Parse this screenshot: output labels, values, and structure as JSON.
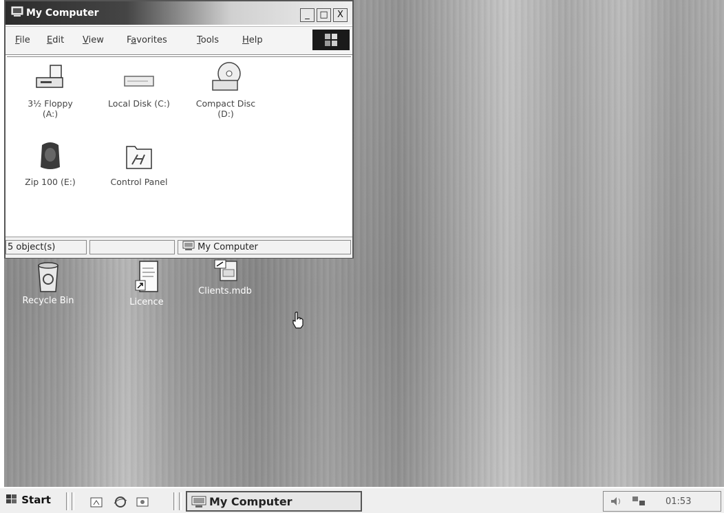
{
  "window": {
    "title": "My Computer",
    "controls": {
      "minimize": "_",
      "maximize": "□",
      "close": "X"
    },
    "menu": [
      {
        "label": "File",
        "mnemonic": "F"
      },
      {
        "label": "Edit",
        "mnemonic": "E"
      },
      {
        "label": "View",
        "mnemonic": "V"
      },
      {
        "label": "Favorites",
        "mnemonic": "a"
      },
      {
        "label": "Tools",
        "mnemonic": "T"
      },
      {
        "label": "Help",
        "mnemonic": "H"
      }
    ],
    "items": [
      {
        "line1": "3½ Floppy",
        "line2": "(A:)",
        "icon": "floppy-drive-icon"
      },
      {
        "line1": "Local Disk (C:)",
        "line2": "",
        "icon": "hard-disk-icon"
      },
      {
        "line1": "Compact Disc",
        "line2": "(D:)",
        "icon": "cd-drive-icon"
      },
      {
        "line1": "Zip 100 (E:)",
        "line2": "",
        "icon": "zip-drive-icon"
      },
      {
        "line1": "Control Panel",
        "line2": "",
        "icon": "control-panel-icon"
      }
    ],
    "status": {
      "count": "5 object(s)",
      "blank": "",
      "location": "My Computer"
    }
  },
  "desktop": {
    "icons": [
      {
        "label": "Recycle Bin",
        "icon": "recycle-bin-icon"
      },
      {
        "label": "Licence",
        "icon": "document-shortcut-icon"
      },
      {
        "label": "Clients.mdb",
        "icon": "database-file-icon"
      }
    ]
  },
  "taskbar": {
    "start": "Start",
    "quick_launch": [
      "show-desktop-icon",
      "internet-explorer-icon",
      "outlook-icon"
    ],
    "task": "My Computer",
    "clock": "01:53 ",
    "tray_icons": [
      "volume-icon",
      "network-icon"
    ]
  }
}
